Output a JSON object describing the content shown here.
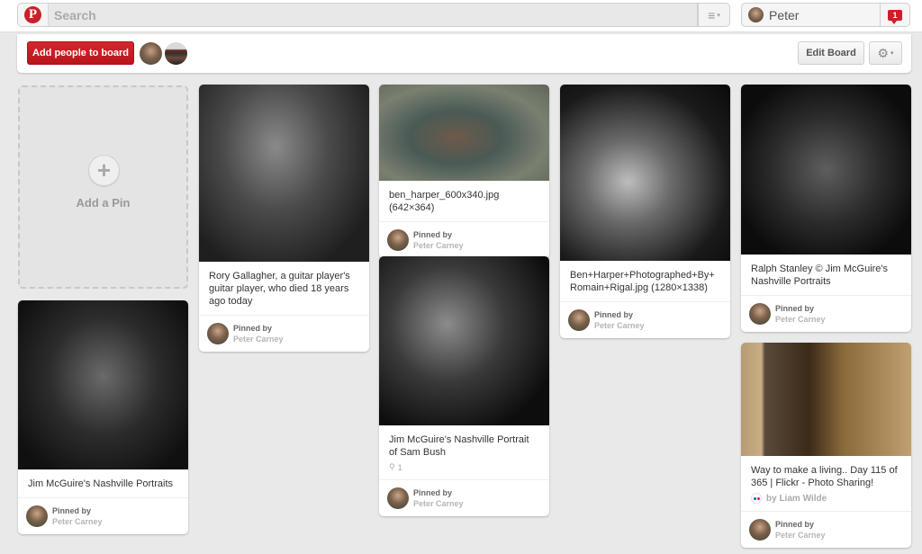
{
  "header": {
    "logo_glyph": "P",
    "logo_name": "pinterest-logo",
    "search_placeholder": "Search",
    "menu_glyph": "≡",
    "caret_glyph": "▾",
    "user_name": "Peter",
    "notification_count": "1"
  },
  "boardbar": {
    "add_people_label": "Add people to board",
    "edit_board_label": "Edit Board",
    "gear_glyph": "⚙",
    "caret_glyph": "▾"
  },
  "add_pin": {
    "plus_glyph": "+",
    "label": "Add a Pin"
  },
  "pins": [
    {
      "description": "Jim McGuire's Nashville Portraits",
      "pinned_by_label": "Pinned by",
      "pinner": "Peter Carney"
    },
    {
      "description": "Rory Gallagher, a guitar player's guitar player, who died 18 years ago today",
      "pinned_by_label": "Pinned by",
      "pinner": "Peter Carney"
    },
    {
      "description": "ben_harper_600x340.jpg (642×364)",
      "pinned_by_label": "Pinned by",
      "pinner": "Peter Carney"
    },
    {
      "description": "Jim McGuire's Nashville Portrait of Sam Bush",
      "repin_glyph": "⚲",
      "repin_count": "1",
      "pinned_by_label": "Pinned by",
      "pinner": "Peter Carney"
    },
    {
      "description": "Ben+Harper+Photographed+By+Romain+Rigal.jpg (1280×1338)",
      "pinned_by_label": "Pinned by",
      "pinner": "Peter Carney"
    },
    {
      "description": "Ralph Stanley © Jim McGuire's Nashville Portraits",
      "pinned_by_label": "Pinned by",
      "pinner": "Peter Carney"
    },
    {
      "description": "Way to make a living.. Day 115 of 365 | Flickr - Photo Sharing!",
      "source": "by Liam Wilde",
      "pinned_by_label": "Pinned by",
      "pinner": "Peter Carney"
    }
  ],
  "colors": {
    "brand_red": "#cb2027",
    "background": "#e9e9e9",
    "flickr_blue": "#0063dc",
    "flickr_pink": "#ff0084"
  }
}
